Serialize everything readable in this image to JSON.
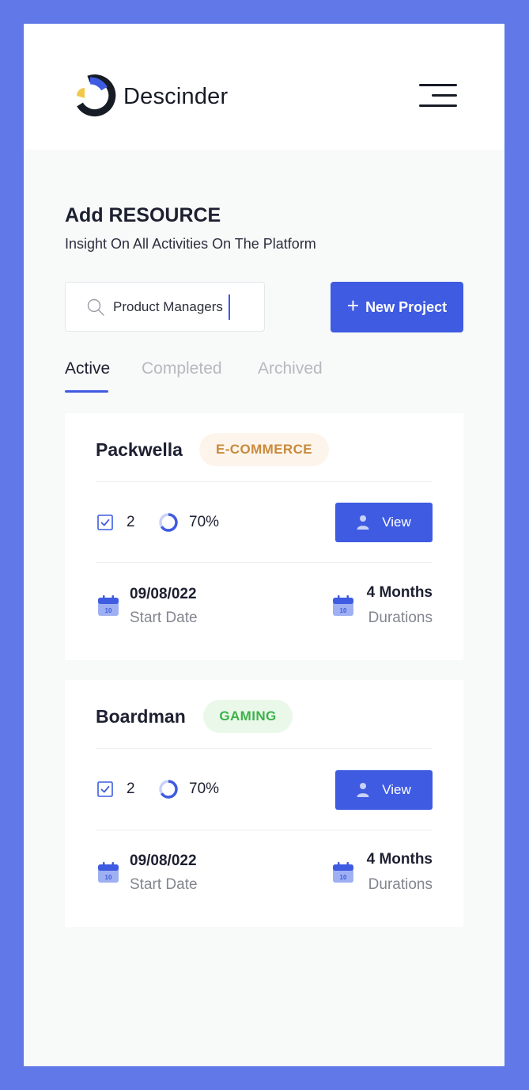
{
  "brand": {
    "name": "Descinder"
  },
  "header": {
    "title": "Add RESOURCE",
    "subtitle": "Insight On All Activities On The Platform"
  },
  "search": {
    "value": "Product Managers"
  },
  "actions": {
    "new_project": "New Project"
  },
  "tabs": [
    {
      "label": "Active",
      "active": true
    },
    {
      "label": "Completed",
      "active": false
    },
    {
      "label": "Archived",
      "active": false
    }
  ],
  "projects": [
    {
      "name": "Packwella",
      "category": "E-COMMERCE",
      "category_color": "#c98a3c",
      "category_bg": "#fdf5ec",
      "tasks": "2",
      "progress": "70%",
      "view_label": "View",
      "start_date": "09/08/022",
      "start_label": "Start Date",
      "duration": "4 Months",
      "duration_label": "Durations"
    },
    {
      "name": "Boardman",
      "category": "GAMING",
      "category_color": "#3cb24a",
      "category_bg": "#eaf8ea",
      "tasks": "2",
      "progress": "70%",
      "view_label": "View",
      "start_date": "09/08/022",
      "start_label": "Start Date",
      "duration": "4 Months",
      "duration_label": "Durations"
    }
  ],
  "icons": {
    "logo": "descinder-logo-icon",
    "menu": "hamburger-menu-icon",
    "search": "search-icon",
    "plus": "plus-icon",
    "task": "checkbox-icon",
    "progress": "progress-ring-icon",
    "user": "user-icon",
    "calendar": "calendar-icon"
  },
  "colors": {
    "accent": "#3e5be2",
    "frame": "#6078e8"
  }
}
